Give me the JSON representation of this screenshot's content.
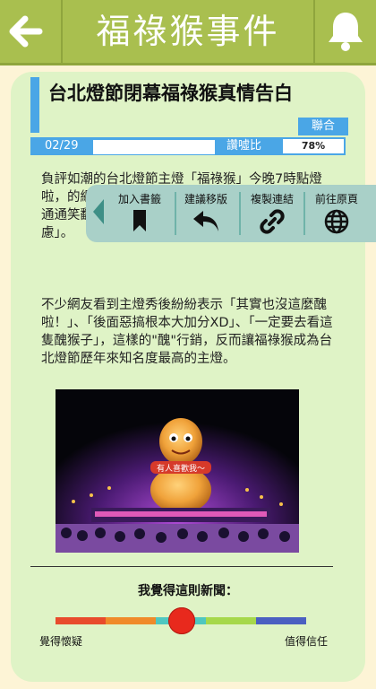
{
  "header": {
    "title": "福祿猴事件",
    "back_icon": "left-arrow-icon",
    "notification_icon": "bell-icon"
  },
  "article": {
    "title": "台北燈節閉幕福祿猴真情告白",
    "source": "聯合",
    "date": "02/29",
    "ratio_label": "讚噓比",
    "ratio_value": "78%",
    "paragraph1": "負評如潮的台北燈節主燈「福祿猴」今晚7時點燈啦，的網友，多\"醜\"，上各種Kuso投影，現場民眾通通笑翻，柯P也坦承在台下觀看的時候「內心很焦慮」。",
    "paragraph2": "不少網友看到主燈秀後紛紛表示「其實也沒這麼醜啦！」、「後面惡搞根本大加分XD」、「一定要去看這隻醜猴子」，這樣的\"醜\"行銷，反而讓福祿猴成為台北燈節歷年來知名度最高的主燈。",
    "photo_caption": "有人喜歡我～"
  },
  "actions": [
    {
      "label": "加入書籤",
      "icon": "bookmark-icon"
    },
    {
      "label": "建議移版",
      "icon": "reply-arrow-icon"
    },
    {
      "label": "複製連結",
      "icon": "link-icon"
    },
    {
      "label": "前往原頁",
      "icon": "globe-icon"
    }
  ],
  "feedback": {
    "question": "我覺得這則新聞：",
    "left_label": "覺得懷疑",
    "right_label": "值得信任",
    "slider_level": 0.5,
    "colors": [
      "#e84b2c",
      "#f08a2a",
      "#4fc7c0",
      "#a6d84b",
      "#4b5fc1"
    ]
  },
  "colors": {
    "header": "#a9bf4f",
    "accent": "#4aa6e6",
    "card": "#dff3c6",
    "actionbar": "#a9d0c8"
  }
}
